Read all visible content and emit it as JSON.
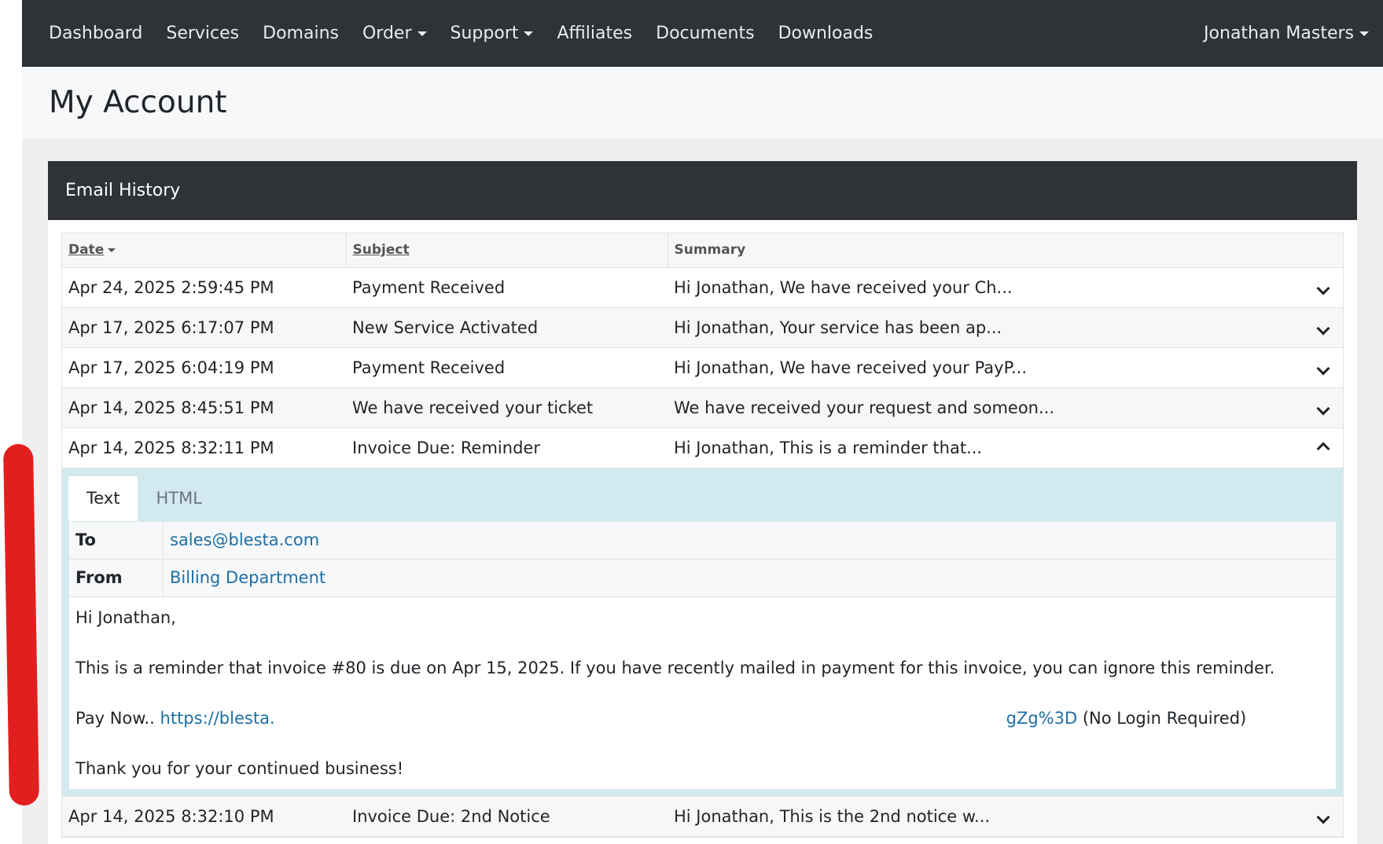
{
  "nav": {
    "items": [
      {
        "label": "Dashboard",
        "dropdown": false
      },
      {
        "label": "Services",
        "dropdown": false
      },
      {
        "label": "Domains",
        "dropdown": false
      },
      {
        "label": "Order",
        "dropdown": true
      },
      {
        "label": "Support",
        "dropdown": true
      },
      {
        "label": "Affiliates",
        "dropdown": false
      },
      {
        "label": "Documents",
        "dropdown": false
      },
      {
        "label": "Downloads",
        "dropdown": false
      }
    ],
    "user": "Jonathan Masters"
  },
  "page": {
    "title": "My Account"
  },
  "card": {
    "title": "Email History"
  },
  "table": {
    "headers": {
      "date": "Date",
      "subject": "Subject",
      "summary": "Summary"
    },
    "rows": [
      {
        "date": "Apr 24, 2025 2:59:45 PM",
        "subject": "Payment Received",
        "summary": "Hi Jonathan, We have received your Ch..."
      },
      {
        "date": "Apr 17, 2025 6:17:07 PM",
        "subject": "New Service Activated",
        "summary": "Hi Jonathan, Your service has been ap..."
      },
      {
        "date": "Apr 17, 2025 6:04:19 PM",
        "subject": "Payment Received",
        "summary": "Hi Jonathan, We have received your PayP..."
      },
      {
        "date": "Apr 14, 2025 8:45:51 PM",
        "subject": "We have received your ticket",
        "summary": "We have received your request and someon..."
      },
      {
        "date": "Apr 14, 2025 8:32:11 PM",
        "subject": "Invoice Due: Reminder",
        "summary": "Hi Jonathan, This is a reminder that..."
      },
      {
        "date": "Apr 14, 2025 8:32:10 PM",
        "subject": "Invoice Due: 2nd Notice",
        "summary": "Hi Jonathan, This is the 2nd notice w..."
      }
    ]
  },
  "detail": {
    "tabs": [
      "Text",
      "HTML"
    ],
    "to_label": "To",
    "to_value": "sales@blesta.com",
    "from_label": "From",
    "from_value": "Billing Department",
    "greeting": "Hi Jonathan,",
    "message": "This is a reminder that invoice #80 is due on Apr 15, 2025. If you have recently mailed in payment for this invoice, you can ignore this reminder.",
    "pay_prefix": "Pay Now.. ",
    "pay_link_start": "https://blesta.",
    "pay_link_end": "gZg%3D",
    "pay_suffix": " (No Login Required)",
    "closing": "Thank you for your continued business!"
  },
  "annotation": {
    "color": "#e21f1f"
  }
}
